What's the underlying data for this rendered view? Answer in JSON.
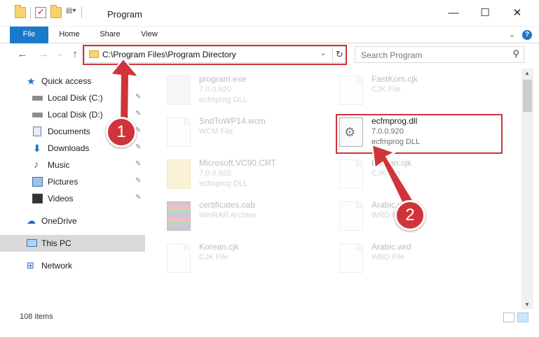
{
  "window": {
    "title": "Program",
    "minimize_glyph": "—",
    "maximize_glyph": "☐",
    "close_glyph": "✕"
  },
  "ribbon": {
    "tabs": [
      "File",
      "Home",
      "Share",
      "View"
    ],
    "help_glyph": "?",
    "expand_glyph": "⌄"
  },
  "navigation": {
    "back_glyph": "←",
    "forward_glyph": "→",
    "recent_glyph": "⌄",
    "up_glyph": "↑",
    "address_path": "C:\\Program Files\\Program Directory",
    "dropdown_glyph": "⌄",
    "refresh_glyph": "↻",
    "search_placeholder": "Search Program",
    "search_glyph": "⚲"
  },
  "sidebar": {
    "items": [
      {
        "label": "Quick access",
        "icon": "star-icon"
      },
      {
        "label": "Local Disk (C:)",
        "icon": "disk-icon",
        "pinned": true
      },
      {
        "label": "Local Disk (D:)",
        "icon": "disk-icon",
        "pinned": true
      },
      {
        "label": "Documents",
        "icon": "documents-icon",
        "pinned": true
      },
      {
        "label": "Downloads",
        "icon": "downloads-icon",
        "pinned": true
      },
      {
        "label": "Music",
        "icon": "music-icon",
        "pinned": true
      },
      {
        "label": "Pictures",
        "icon": "pictures-icon",
        "pinned": true
      },
      {
        "label": "Videos",
        "icon": "videos-icon",
        "pinned": true
      },
      {
        "label": "OneDrive",
        "icon": "cloud-icon"
      },
      {
        "label": "This PC",
        "icon": "computer-icon",
        "selected": true
      },
      {
        "label": "Network",
        "icon": "network-icon"
      }
    ],
    "pin_glyph": "📌"
  },
  "files": [
    {
      "name": "program.exe",
      "line2": "7.0.0.920",
      "line3": "ecfmprog DLL",
      "icon": "exe-icon"
    },
    {
      "name": "FastKom.cjk",
      "line2": "CJK File",
      "icon": "document-icon"
    },
    {
      "name": "SndToWP14.wcm",
      "line2": "WCM File",
      "icon": "document-icon"
    },
    {
      "name": "ecfmprog.dll",
      "line2": "7.0.0.920",
      "line3": "ecfmprog DLL",
      "icon": "dll-icon"
    },
    {
      "name": "Microsoft.VC90.CRT",
      "line2": "7.0.0.920",
      "line3": "ecfmprog DLL",
      "icon": "folder-icon"
    },
    {
      "name": "Korean.cjk",
      "line2": "CJK File",
      "icon": "document-icon"
    },
    {
      "name": "certificates.cab",
      "line2": "WinRAR Archive",
      "icon": "archive-icon"
    },
    {
      "name": "Arabic.wrd",
      "line2": "WRD File",
      "icon": "document-icon"
    },
    {
      "name": "Korean.cjk",
      "line2": "CJK File",
      "icon": "document-icon"
    },
    {
      "name": "Arabic.wrd",
      "line2": "WRD File",
      "icon": "document-icon"
    }
  ],
  "status": {
    "item_count": "108 items"
  },
  "annotations": {
    "step1": "1",
    "step2": "2",
    "highlight_color": "#d0343a"
  },
  "colors": {
    "accent": "#1979ca",
    "selection": "#d9d9d9"
  }
}
